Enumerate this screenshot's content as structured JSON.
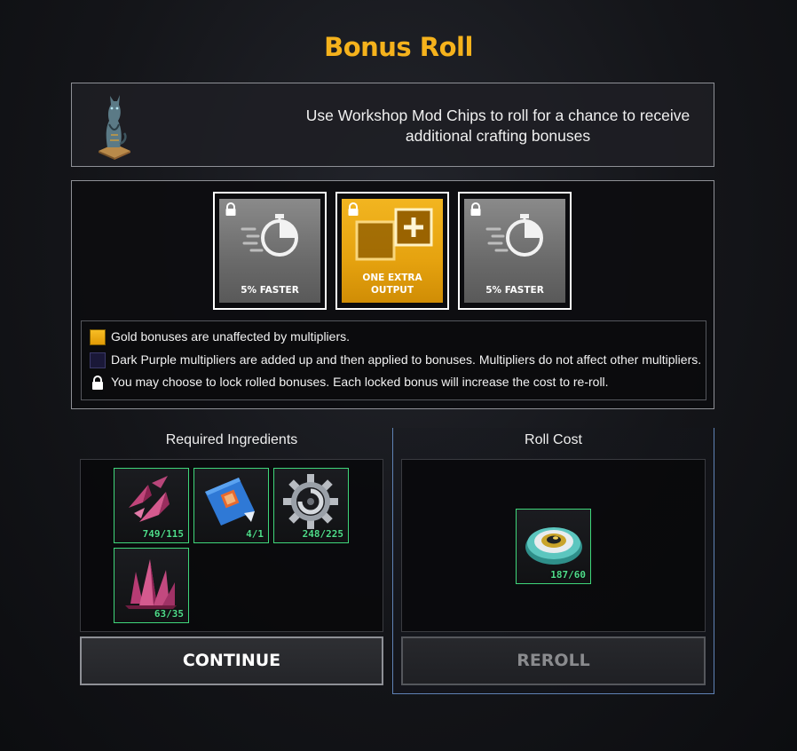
{
  "title": "Bonus Roll",
  "intro": {
    "line1": "Use Workshop Mod Chips to roll for a chance to receive",
    "line2": "additional crafting bonuses",
    "image": "cat-statue-icon"
  },
  "bonuses": [
    {
      "label": "5% FASTER",
      "style": "gray",
      "icon": "stopwatch-icon",
      "locked": true
    },
    {
      "label_line1": "ONE EXTRA",
      "label_line2": "OUTPUT",
      "style": "gold",
      "icon": "extra-output-icon",
      "locked": true
    },
    {
      "label": "5% FASTER",
      "style": "gray",
      "icon": "stopwatch-icon",
      "locked": true
    }
  ],
  "legend": {
    "gold": "Gold bonuses are unaffected by multipliers.",
    "purple": "Dark Purple multipliers are added up and then applied to bonuses. Multipliers do not affect other multipliers.",
    "lock": "You may choose to lock rolled bonuses. Each locked bonus will increase the cost to re-roll."
  },
  "ingredients": {
    "heading": "Required Ingredients",
    "items": [
      {
        "icon": "crystal-shard-icon",
        "count": "749/115"
      },
      {
        "icon": "blueprint-icon",
        "count": "4/1"
      },
      {
        "icon": "gear-icon",
        "count": "248/225"
      },
      {
        "icon": "crystal-cluster-icon",
        "count": "63/35"
      }
    ]
  },
  "roll_cost": {
    "heading": "Roll Cost",
    "items": [
      {
        "icon": "mod-chip-icon",
        "count": "187/60"
      }
    ]
  },
  "buttons": {
    "continue": "CONTINUE",
    "reroll": "REROLL"
  },
  "colors": {
    "title": "#f5b21c",
    "gold_bonus": "#e5a20f",
    "gray_bonus": "#7a7a7a",
    "count_text": "#4fdc8a",
    "slot_border": "#3fd67a",
    "roll_cost_border": "#5f82b5"
  }
}
